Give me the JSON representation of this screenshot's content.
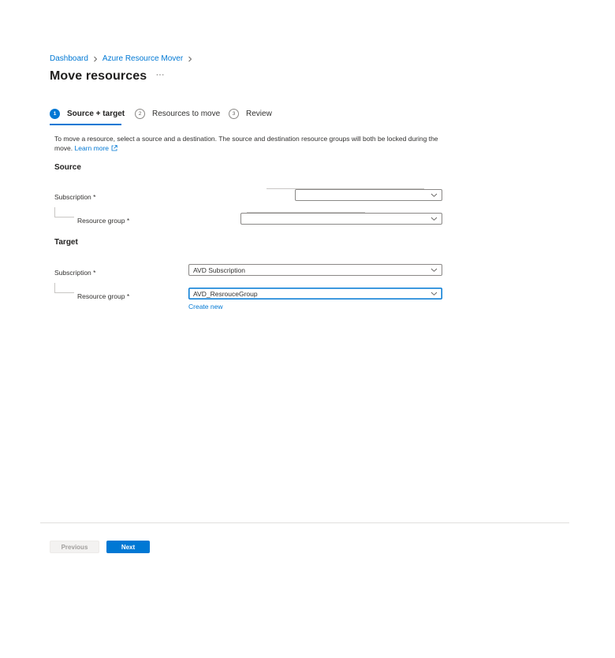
{
  "breadcrumb": {
    "items": [
      "Dashboard",
      "Azure Resource Mover"
    ]
  },
  "page": {
    "title": "Move resources",
    "more_label": "···"
  },
  "wizard": {
    "steps": [
      {
        "number": "1",
        "label": "Source + target",
        "active": true
      },
      {
        "number": "2",
        "label": "Resources to move",
        "active": false
      },
      {
        "number": "3",
        "label": "Review",
        "active": false
      }
    ]
  },
  "description": {
    "text": "To move a resource, select a source and a destination. The source and destination resource groups will both be locked during the move.",
    "link": "Learn more"
  },
  "source": {
    "heading": "Source",
    "subscription_label": "Subscription *",
    "subscription_value": "",
    "resource_group_label": "Resource group *",
    "resource_group_value": ""
  },
  "target": {
    "heading": "Target",
    "subscription_label": "Subscription *",
    "subscription_value": "AVD Subscription",
    "resource_group_label": "Resource group *",
    "resource_group_value": "AVD_ResrouceGroup",
    "create_new": "Create new"
  },
  "footer": {
    "previous_label": "Previous",
    "next_label": "Next"
  },
  "colors": {
    "accent": "#0078d4",
    "text": "#323130",
    "border": "#8a8886"
  }
}
